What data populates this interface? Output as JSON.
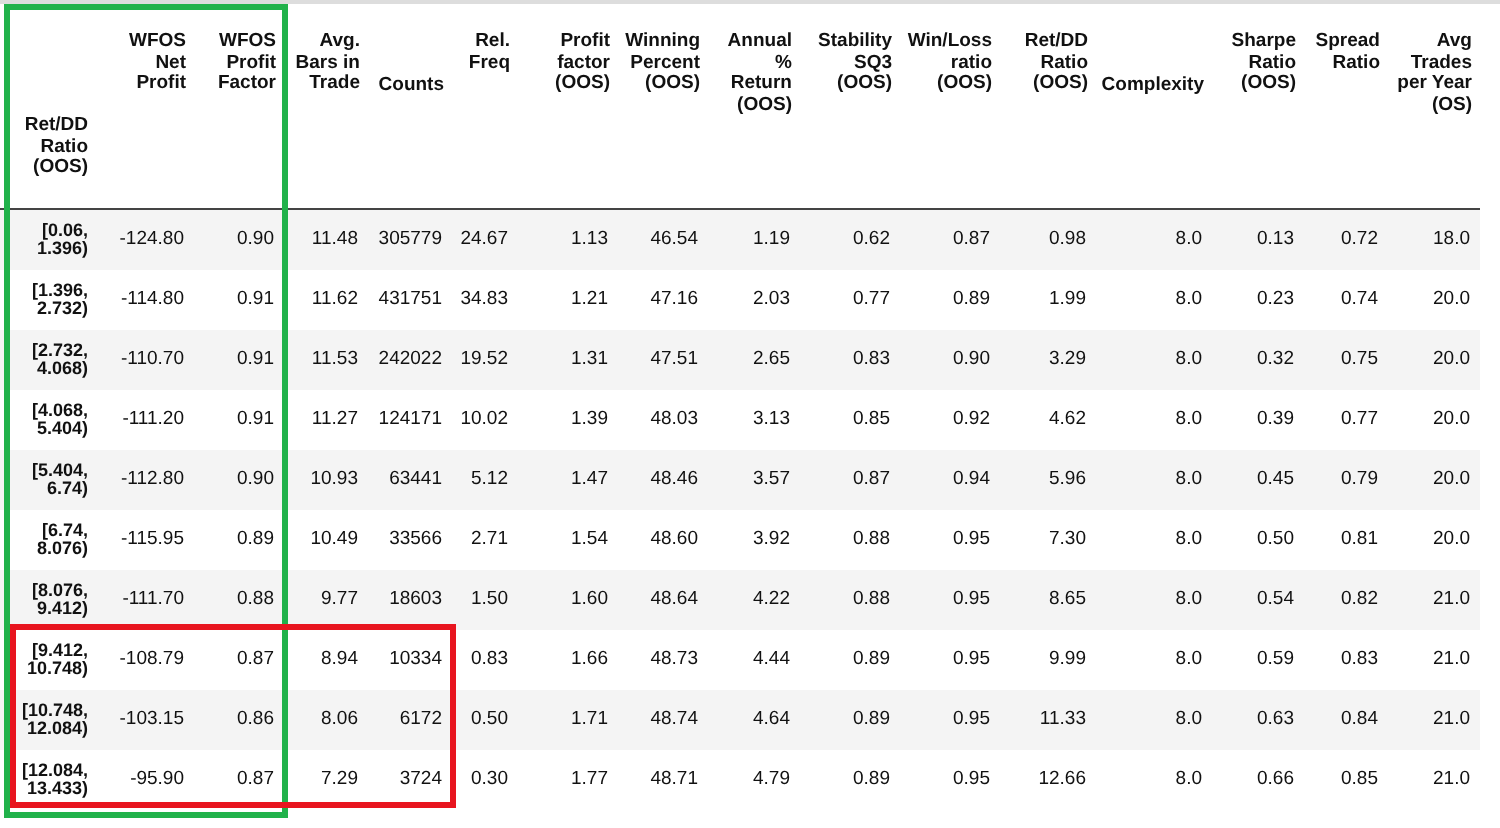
{
  "table": {
    "index_header": "Ret/DD\nRatio\n(OOS)",
    "columns": [
      "WFOS\nNet\nProfit",
      "WFOS\nProfit\nFactor",
      "Avg.\nBars in\nTrade",
      "Counts",
      "Rel.\nFreq",
      "Profit\nfactor\n(OOS)",
      "Winning\nPercent\n(OOS)",
      "Annual\n%\nReturn\n(OOS)",
      "Stability\nSQ3\n(OOS)",
      "Win/Loss\nratio\n(OOS)",
      "Ret/DD\nRatio\n(OOS)",
      "Complexity",
      "Sharpe\nRatio\n(OOS)",
      "Spread\nRatio",
      "Avg\nTrades\nper Year\n(OS)"
    ],
    "rows": [
      {
        "index": "[0.06,\n1.396)",
        "cells": [
          "-124.80",
          "0.90",
          "11.48",
          "305779",
          "24.67",
          "1.13",
          "46.54",
          "1.19",
          "0.62",
          "0.87",
          "0.98",
          "8.0",
          "0.13",
          "0.72",
          "18.0"
        ]
      },
      {
        "index": "[1.396,\n2.732)",
        "cells": [
          "-114.80",
          "0.91",
          "11.62",
          "431751",
          "34.83",
          "1.21",
          "47.16",
          "2.03",
          "0.77",
          "0.89",
          "1.99",
          "8.0",
          "0.23",
          "0.74",
          "20.0"
        ]
      },
      {
        "index": "[2.732,\n4.068)",
        "cells": [
          "-110.70",
          "0.91",
          "11.53",
          "242022",
          "19.52",
          "1.31",
          "47.51",
          "2.65",
          "0.83",
          "0.90",
          "3.29",
          "8.0",
          "0.32",
          "0.75",
          "20.0"
        ]
      },
      {
        "index": "[4.068,\n5.404)",
        "cells": [
          "-111.20",
          "0.91",
          "11.27",
          "124171",
          "10.02",
          "1.39",
          "48.03",
          "3.13",
          "0.85",
          "0.92",
          "4.62",
          "8.0",
          "0.39",
          "0.77",
          "20.0"
        ]
      },
      {
        "index": "[5.404,\n6.74)",
        "cells": [
          "-112.80",
          "0.90",
          "10.93",
          "63441",
          "5.12",
          "1.47",
          "48.46",
          "3.57",
          "0.87",
          "0.94",
          "5.96",
          "8.0",
          "0.45",
          "0.79",
          "20.0"
        ]
      },
      {
        "index": "[6.74,\n8.076)",
        "cells": [
          "-115.95",
          "0.89",
          "10.49",
          "33566",
          "2.71",
          "1.54",
          "48.60",
          "3.92",
          "0.88",
          "0.95",
          "7.30",
          "8.0",
          "0.50",
          "0.81",
          "20.0"
        ]
      },
      {
        "index": "[8.076,\n9.412)",
        "cells": [
          "-111.70",
          "0.88",
          "9.77",
          "18603",
          "1.50",
          "1.60",
          "48.64",
          "4.22",
          "0.88",
          "0.95",
          "8.65",
          "8.0",
          "0.54",
          "0.82",
          "21.0"
        ]
      },
      {
        "index": "[9.412,\n10.748)",
        "cells": [
          "-108.79",
          "0.87",
          "8.94",
          "10334",
          "0.83",
          "1.66",
          "48.73",
          "4.44",
          "0.89",
          "0.95",
          "9.99",
          "8.0",
          "0.59",
          "0.83",
          "21.0"
        ]
      },
      {
        "index": "[10.748,\n12.084)",
        "cells": [
          "-103.15",
          "0.86",
          "8.06",
          "6172",
          "0.50",
          "1.71",
          "48.74",
          "4.64",
          "0.89",
          "0.95",
          "11.33",
          "8.0",
          "0.63",
          "0.84",
          "21.0"
        ]
      },
      {
        "index": "[12.084,\n13.433)",
        "cells": [
          "-95.90",
          "0.87",
          "7.29",
          "3724",
          "0.30",
          "1.77",
          "48.71",
          "4.79",
          "0.89",
          "0.95",
          "12.66",
          "8.0",
          "0.66",
          "0.85",
          "21.0"
        ]
      }
    ]
  },
  "highlights": [
    {
      "kind": "columns",
      "color": "#21b24b"
    },
    {
      "kind": "rows",
      "color": "#e8151f"
    }
  ]
}
